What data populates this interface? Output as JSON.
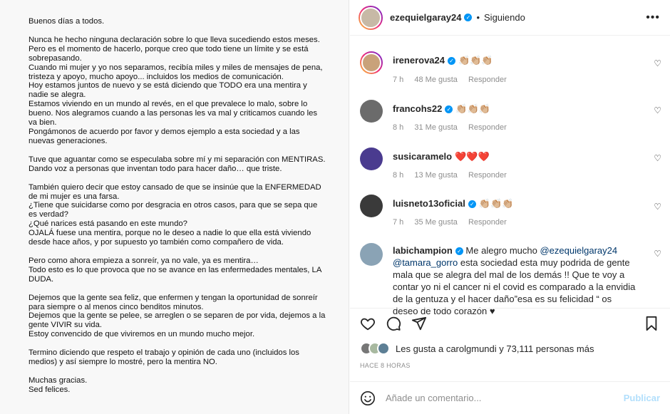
{
  "letter": {
    "paragraphs": [
      "Buenos días a todos.",
      "Nunca he hecho ninguna declaración sobre lo que lleva sucediendo estos meses.\nPero es el momento de hacerlo, porque creo que todo tiene un límite y se está\nsobrepasando.\nCuando mi mujer y yo nos separamos, recibía miles y miles de mensajes de pena,\ntristeza y apoyo, mucho apoyo... incluidos los medios de comunicación.\nHoy estamos juntos de nuevo y se está diciendo que TODO era una mentira y\nnadie se alegra.\nEstamos viviendo en un mundo al revés, en el que prevalece lo malo, sobre lo\nbueno. Nos alegramos cuando a las personas les va mal y criticamos cuando les\nva bien.\nPongámonos de acuerdo por favor y demos ejemplo a esta sociedad y a las\nnuevas generaciones.",
      "Tuve que aguantar como se especulaba sobre mí y mi separación con MENTIRAS.\nDando voz a personas que inventan todo para hacer daño… que triste.",
      "También quiero decir que estoy cansado de que se insinúe que la ENFERMEDAD\nde mi mujer es una farsa.\n¿Tiene que suicidarse como por desgracia en otros casos, para que se sepa que\nes verdad?\n¿Qué narices está pasando en este mundo?\nOJALÁ fuese una mentira, porque no le deseo a nadie lo que ella está viviendo\ndesde hace años, y por supuesto yo también como compañero de vida.",
      "Pero como ahora empieza a sonreír, ya no vale, ya es mentira…\nTodo esto es lo que provoca que no se avance en las enfermedades mentales, LA\nDUDA.",
      "Dejemos que la gente sea feliz, que enfermen y tengan la oportunidad de sonreír\npara siempre o al menos cinco benditos minutos.\nDejemos que la gente se pelee, se arreglen o se separen de por vida, dejemos a la\ngente VIVIR su vida.\nEstoy convencido de que viviremos en un mundo mucho mejor.",
      "Termino diciendo que respeto el trabajo y opinión de cada uno (incluidos los\nmedios) y así siempre lo mostré, pero la mentira NO.",
      "Muchas gracias.\nSed felices."
    ]
  },
  "header": {
    "username": "ezequielgaray24",
    "separator": "•",
    "following": "Siguiendo",
    "more_icon": "more-horizontal-icon"
  },
  "comments": [
    {
      "user": "irenerova24",
      "text": "👏🏼👏🏼👏🏼",
      "time": "7 h",
      "likes": "48 Me gusta",
      "reply": "Responder",
      "avatar_color": "#c9a27a"
    },
    {
      "user": "francohs22",
      "text": "👏🏼👏🏼👏🏼",
      "time": "8 h",
      "likes": "31 Me gusta",
      "reply": "Responder",
      "avatar_color": "#6b6b6b"
    },
    {
      "user": "susicaramelo",
      "text": "❤️❤️❤️",
      "time": "8 h",
      "likes": "13 Me gusta",
      "reply": "Responder",
      "avatar_color": "#4a3b8f"
    },
    {
      "user": "luisneto13oficial",
      "text": "👏🏼👏🏼👏🏼",
      "time": "7 h",
      "likes": "35 Me gusta",
      "reply": "Responder",
      "avatar_color": "#3a3a3a"
    },
    {
      "user": "labichampion",
      "pre": "Me alegro mucho ",
      "mention1": "@ezequielgaray24",
      "mention2": "@tamara_gorro",
      "text": " esta sociedad esta muy podrida de gente mala que se alegra del mal de los demás !! Que te voy a contar yo ni el cancer ni el covid es comparado a la envidia de la gentuza y el hacer daño”esa es su felicidad “ os deseo de todo corazón ♥",
      "avatar_color": "#8aa3b5"
    }
  ],
  "likes_line": {
    "text": "Les gusta a carolgmundi y 73,111 personas más"
  },
  "time_ago": "HACE 8 HORAS",
  "composer": {
    "placeholder": "Añade un comentario...",
    "publish": "Publicar"
  },
  "colors": {
    "accent": "#0095f6",
    "publish_disabled": "#b2dffc",
    "muted": "#8e8e8e"
  }
}
